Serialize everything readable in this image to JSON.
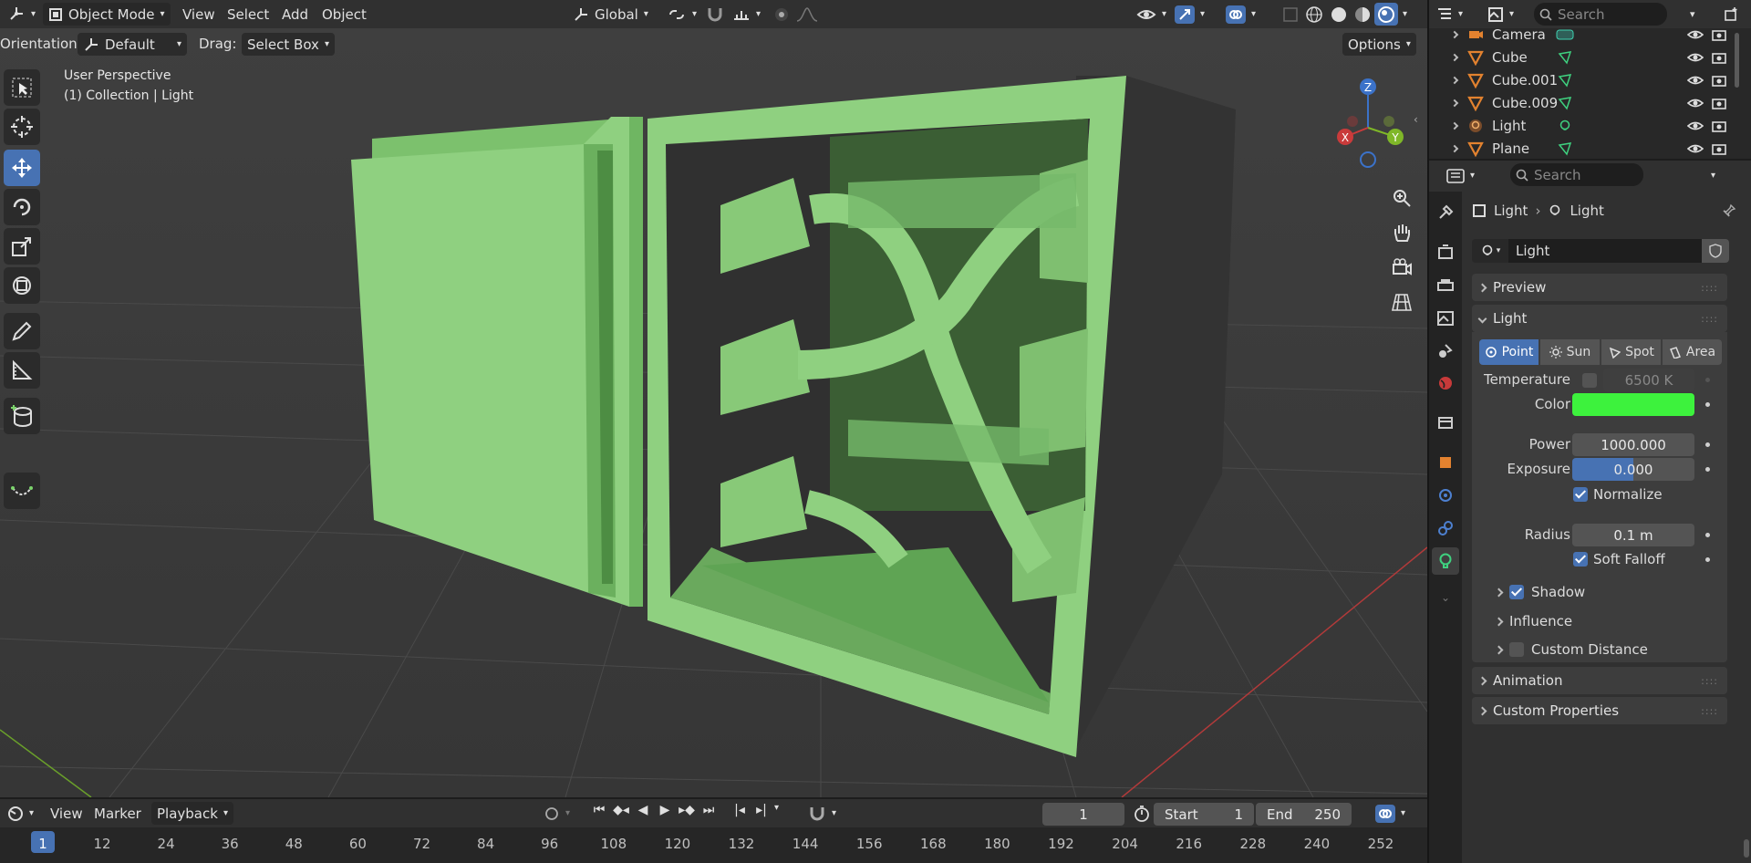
{
  "header": {
    "mode": "Object Mode",
    "menus": [
      "View",
      "Select",
      "Add",
      "Object"
    ],
    "transform": "Global",
    "search_placeholder": "Search"
  },
  "tool_settings": {
    "orientation_label": "Orientation:",
    "orientation_value": "Default",
    "drag_label": "Drag:",
    "drag_value": "Select Box",
    "options": "Options"
  },
  "viewport": {
    "perspective": "User Perspective",
    "collection": "(1) Collection | Light",
    "gizmo": {
      "z": "Z",
      "y": "Y",
      "x": "X"
    }
  },
  "outliner": {
    "rows": [
      {
        "name": "Camera",
        "icon": "camera-icon"
      },
      {
        "name": "Cube",
        "icon": "mesh-icon"
      },
      {
        "name": "Cube.001",
        "icon": "mesh-icon"
      },
      {
        "name": "Cube.009",
        "icon": "mesh-icon"
      },
      {
        "name": "Light",
        "icon": "light-icon"
      },
      {
        "name": "Plane",
        "icon": "mesh-icon"
      }
    ]
  },
  "properties": {
    "search_placeholder": "Search",
    "breadcrumb_object": "Light",
    "breadcrumb_data": "Light",
    "datablock_name": "Light",
    "sections": {
      "preview": "Preview",
      "light": "Light",
      "shadow": "Shadow",
      "influence": "Influence",
      "custom_distance": "Custom Distance",
      "animation": "Animation",
      "custom_properties": "Custom Properties"
    },
    "light_types": [
      "Point",
      "Sun",
      "Spot",
      "Area"
    ],
    "active_type": "Point",
    "temperature_label": "Temperature",
    "temperature_value": "6500 K",
    "color_label": "Color",
    "light_color": "#3df23d",
    "power_label": "Power",
    "power_value": "1000.000",
    "exposure_label": "Exposure",
    "exposure_value": "0.000",
    "normalize_label": "Normalize",
    "radius_label": "Radius",
    "radius_value": "0.1 m",
    "soft_falloff_label": "Soft Falloff"
  },
  "timeline": {
    "menus": [
      "View",
      "Marker",
      "Playback"
    ],
    "current_frame": "1",
    "start_label": "Start",
    "start_value": "1",
    "end_label": "End",
    "end_value": "250",
    "ruler": [
      "1",
      "12",
      "24",
      "36",
      "48",
      "60",
      "72",
      "84",
      "96",
      "108",
      "120",
      "132",
      "144",
      "156",
      "168",
      "180",
      "192",
      "204",
      "216",
      "228",
      "240",
      "252"
    ]
  },
  "colors": {
    "accent": "#4772b3",
    "model_green": "#8fcf7f",
    "viewport_bg": "#3d3d3d"
  }
}
